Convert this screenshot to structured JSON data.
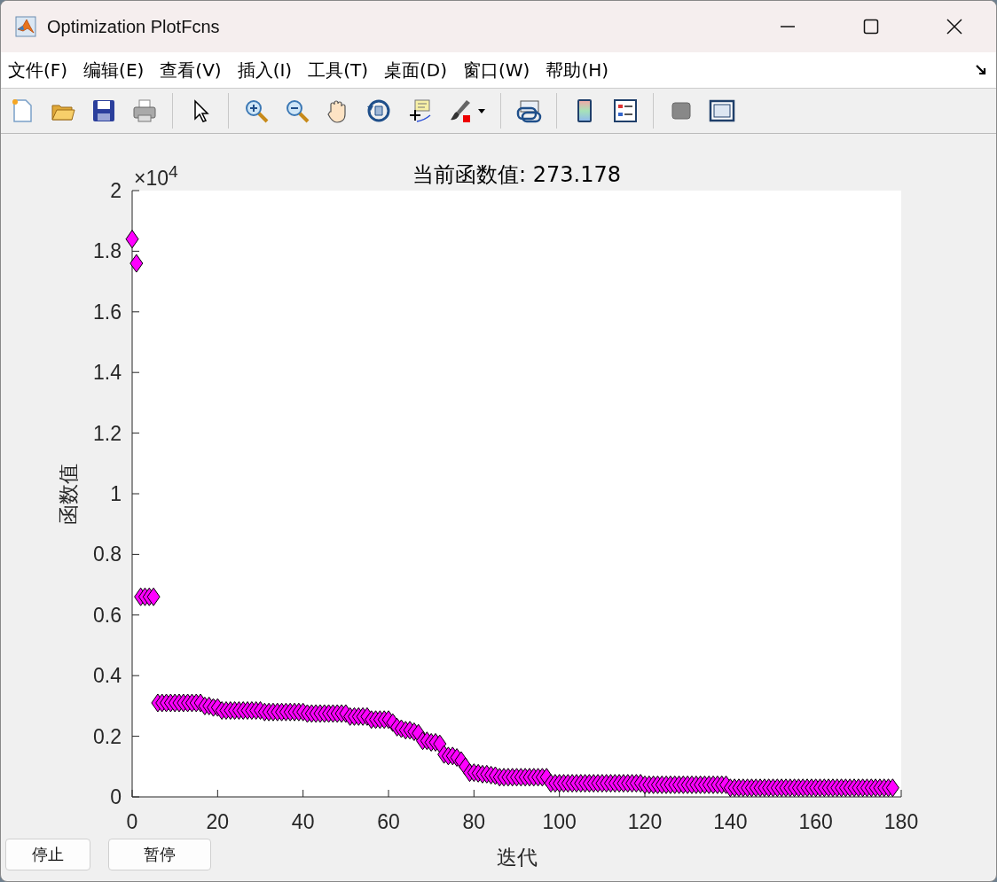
{
  "window": {
    "title": "Optimization PlotFcns"
  },
  "menu": [
    {
      "label": "文件(F)"
    },
    {
      "label": "编辑(E)"
    },
    {
      "label": "查看(V)"
    },
    {
      "label": "插入(I)"
    },
    {
      "label": "工具(T)"
    },
    {
      "label": "桌面(D)"
    },
    {
      "label": "窗口(W)"
    },
    {
      "label": "帮助(H)"
    }
  ],
  "plot": {
    "y_exponent": "×10$^{4}$",
    "chart_data": {
      "type": "scatter",
      "title": "当前函数值: 273.178",
      "xlabel": "迭代",
      "ylabel": "函数值",
      "xlim": [
        0,
        180
      ],
      "ylim": [
        0,
        2
      ],
      "xticks": [
        0,
        20,
        40,
        60,
        80,
        100,
        120,
        140,
        160,
        180
      ],
      "yticks": [
        0,
        0.2,
        0.4,
        0.6,
        0.8,
        1,
        1.2,
        1.4,
        1.6,
        1.8,
        2
      ],
      "x": [
        0,
        1,
        2,
        3,
        4,
        5,
        6,
        7,
        8,
        9,
        10,
        11,
        12,
        13,
        14,
        15,
        16,
        17,
        18,
        19,
        20,
        21,
        22,
        23,
        24,
        25,
        26,
        27,
        28,
        29,
        30,
        31,
        32,
        33,
        34,
        35,
        36,
        37,
        38,
        39,
        40,
        41,
        42,
        43,
        44,
        45,
        46,
        47,
        48,
        49,
        50,
        51,
        52,
        53,
        54,
        55,
        56,
        57,
        58,
        59,
        60,
        61,
        62,
        63,
        64,
        65,
        66,
        67,
        68,
        69,
        70,
        71,
        72,
        73,
        74,
        75,
        76,
        77,
        78,
        79,
        80,
        81,
        82,
        83,
        84,
        85,
        86,
        87,
        88,
        89,
        90,
        91,
        92,
        93,
        94,
        95,
        96,
        97,
        98,
        99,
        100,
        101,
        102,
        103,
        104,
        105,
        106,
        107,
        108,
        109,
        110,
        111,
        112,
        113,
        114,
        115,
        116,
        117,
        118,
        119,
        120,
        121,
        122,
        123,
        124,
        125,
        126,
        127,
        128,
        129,
        130,
        131,
        132,
        133,
        134,
        135,
        136,
        137,
        138,
        139,
        140,
        141,
        142,
        143,
        144,
        145,
        146,
        147,
        148,
        149,
        150,
        151,
        152,
        153,
        154,
        155,
        156,
        157,
        158,
        159,
        160,
        161,
        162,
        163,
        164,
        165,
        166,
        167,
        168,
        169,
        170,
        171,
        172,
        173,
        174,
        175,
        176,
        177,
        178
      ],
      "series": [
        {
          "color": "#ff00ff",
          "values": [
            1.84,
            1.76,
            0.66,
            0.66,
            0.66,
            0.66,
            0.31,
            0.31,
            0.31,
            0.31,
            0.31,
            0.31,
            0.31,
            0.31,
            0.31,
            0.31,
            0.31,
            0.3,
            0.3,
            0.295,
            0.295,
            0.285,
            0.285,
            0.285,
            0.285,
            0.285,
            0.285,
            0.285,
            0.285,
            0.285,
            0.285,
            0.28,
            0.28,
            0.28,
            0.28,
            0.28,
            0.28,
            0.28,
            0.28,
            0.28,
            0.28,
            0.275,
            0.275,
            0.275,
            0.275,
            0.275,
            0.275,
            0.275,
            0.275,
            0.275,
            0.275,
            0.265,
            0.265,
            0.265,
            0.265,
            0.265,
            0.255,
            0.255,
            0.255,
            0.255,
            0.255,
            0.245,
            0.23,
            0.225,
            0.22,
            0.22,
            0.215,
            0.21,
            0.185,
            0.185,
            0.18,
            0.18,
            0.175,
            0.14,
            0.135,
            0.135,
            0.13,
            0.12,
            0.1,
            0.08,
            0.08,
            0.078,
            0.075,
            0.075,
            0.072,
            0.07,
            0.065,
            0.065,
            0.065,
            0.065,
            0.065,
            0.065,
            0.065,
            0.065,
            0.065,
            0.065,
            0.065,
            0.065,
            0.045,
            0.045,
            0.045,
            0.045,
            0.045,
            0.045,
            0.045,
            0.045,
            0.045,
            0.045,
            0.045,
            0.045,
            0.045,
            0.045,
            0.045,
            0.045,
            0.045,
            0.045,
            0.045,
            0.045,
            0.045,
            0.045,
            0.04,
            0.04,
            0.04,
            0.04,
            0.04,
            0.04,
            0.04,
            0.04,
            0.04,
            0.04,
            0.04,
            0.04,
            0.04,
            0.04,
            0.04,
            0.04,
            0.04,
            0.04,
            0.04,
            0.04,
            0.03,
            0.03,
            0.03,
            0.03,
            0.03,
            0.03,
            0.03,
            0.03,
            0.03,
            0.03,
            0.03,
            0.03,
            0.03,
            0.03,
            0.03,
            0.03,
            0.03,
            0.03,
            0.03,
            0.03,
            0.03,
            0.03,
            0.03,
            0.03,
            0.03,
            0.03,
            0.03,
            0.03,
            0.03,
            0.03,
            0.03,
            0.03,
            0.03,
            0.03,
            0.03,
            0.03,
            0.03,
            0.03,
            0.03
          ]
        }
      ]
    }
  },
  "buttons": [
    {
      "label": "停止"
    },
    {
      "label": "暂停"
    }
  ]
}
